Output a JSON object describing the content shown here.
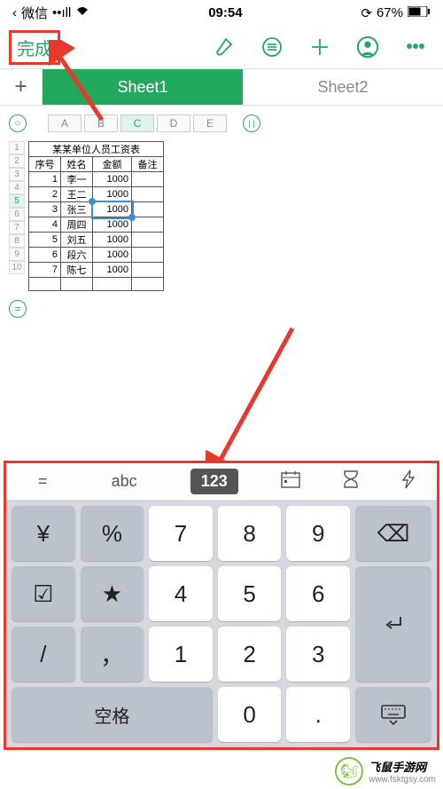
{
  "status_bar": {
    "carrier": "微信",
    "signal": "••ıll",
    "wifi": "wifi-icon",
    "time": "09:54",
    "rotation_lock": "⊗",
    "battery_pct": "67%",
    "battery_icon": "battery"
  },
  "top_toolbar": {
    "done_label": "完成",
    "icons": {
      "brush": "brush",
      "list": "list",
      "add": "+",
      "user": "user",
      "more": "•••"
    }
  },
  "sheet_tabs": {
    "add": "+",
    "tabs": [
      {
        "label": "Sheet1",
        "active": true
      },
      {
        "label": "Sheet2",
        "active": false
      }
    ]
  },
  "column_headers": [
    "A",
    "B",
    "C",
    "D",
    "E"
  ],
  "selected_column": "C",
  "selected_row": "5",
  "row_headers": [
    "1",
    "2",
    "3",
    "4",
    "5",
    "6",
    "7",
    "8",
    "9",
    "10"
  ],
  "table": {
    "title": "某某单位人员工资表",
    "headers": [
      "序号",
      "姓名",
      "金额",
      "备注"
    ],
    "rows": [
      {
        "num": "1",
        "name": "李一",
        "amount": "1000",
        "note": ""
      },
      {
        "num": "2",
        "name": "王二",
        "amount": "1000",
        "note": ""
      },
      {
        "num": "3",
        "name": "张三",
        "amount": "1000",
        "note": ""
      },
      {
        "num": "4",
        "name": "周四",
        "amount": "1000",
        "note": ""
      },
      {
        "num": "5",
        "name": "刘五",
        "amount": "1000",
        "note": ""
      },
      {
        "num": "6",
        "name": "段六",
        "amount": "1000",
        "note": ""
      },
      {
        "num": "7",
        "name": "陈七",
        "amount": "1000",
        "note": ""
      }
    ]
  },
  "keyboard": {
    "top_row": {
      "equals": "=",
      "abc": "abc",
      "num": "123",
      "cal_icon": "calendar",
      "time_icon": "hourglass",
      "bolt_icon": "bolt"
    },
    "keys": {
      "yen": "¥",
      "pct": "%",
      "k7": "7",
      "k8": "8",
      "k9": "9",
      "backspace": "⌫",
      "check": "☑",
      "star": "★",
      "k4": "4",
      "k5": "5",
      "k6": "6",
      "slash": "/",
      "comma": "，",
      "k1": "1",
      "k2": "2",
      "k3": "3",
      "space": "空格",
      "k0": "0",
      "dot": "."
    }
  },
  "watermark": {
    "title": "飞鼠手游网",
    "url": "www.fsktgsy.com"
  },
  "side_controls": {
    "circle_o": "○",
    "circle_pause": "||",
    "circle_eq": "="
  }
}
